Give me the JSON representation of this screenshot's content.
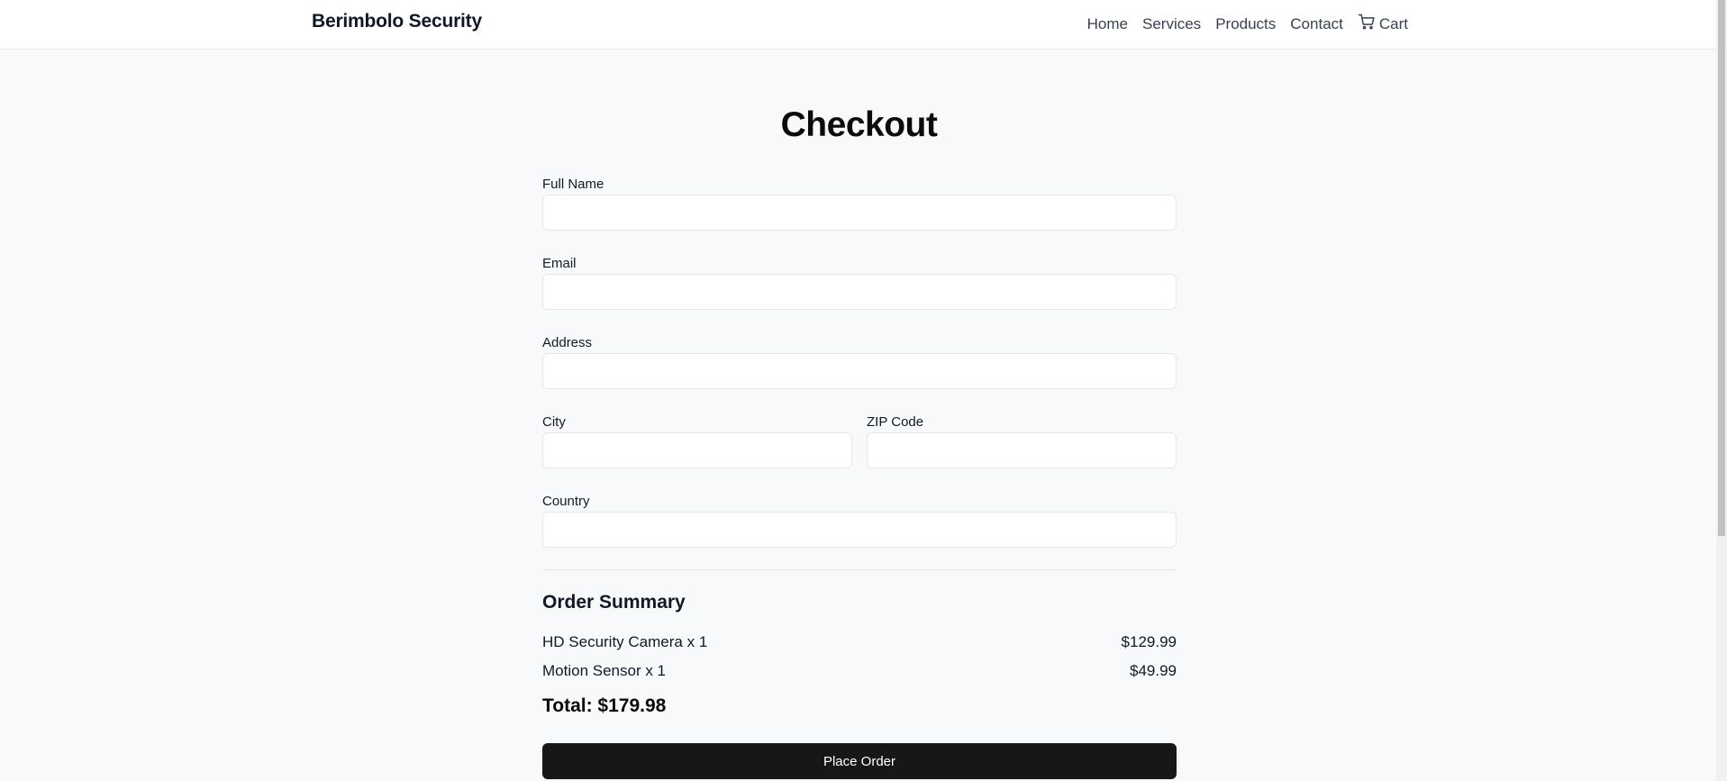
{
  "header": {
    "brand": "Berimbolo Security",
    "nav": {
      "home": "Home",
      "services": "Services",
      "products": "Products",
      "contact": "Contact",
      "cart": "Cart"
    },
    "cart_icon": "cart-icon"
  },
  "page_title": "Checkout",
  "form": {
    "full_name_label": "Full Name",
    "full_name_value": "",
    "email_label": "Email",
    "email_value": "",
    "address_label": "Address",
    "address_value": "",
    "city_label": "City",
    "city_value": "",
    "zip_label": "ZIP Code",
    "zip_value": "",
    "country_label": "Country",
    "country_value": ""
  },
  "order_summary": {
    "title": "Order Summary",
    "items": [
      {
        "name": "HD Security Camera x 1",
        "price": "$129.99"
      },
      {
        "name": "Motion Sensor x 1",
        "price": "$49.99"
      }
    ],
    "total": "Total: $179.98"
  },
  "place_order_label": "Place Order",
  "colors": {
    "background": "#f8f9fa",
    "button": "#171717",
    "button_text": "#ffffff"
  }
}
